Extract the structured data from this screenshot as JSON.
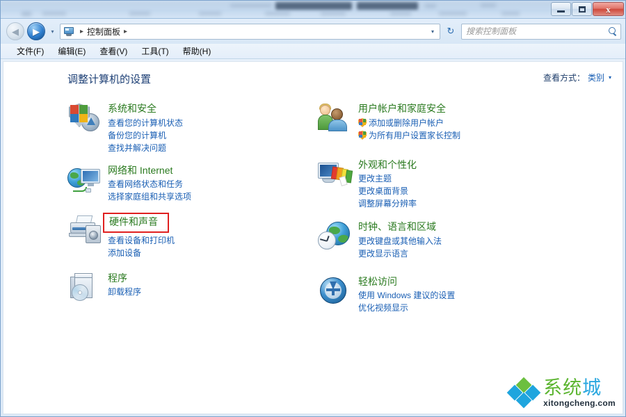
{
  "window": {
    "controls": {
      "minimize": "—",
      "maximize": "❐",
      "close": "x"
    }
  },
  "toolbar": {
    "back_tooltip": "后退",
    "forward_tooltip": "前进",
    "recent_pages_caret": "▾",
    "breadcrumb": {
      "icon": "control-panel-icon",
      "items": [
        "控制面板"
      ],
      "separator": "▸"
    },
    "address_caret": "▾",
    "refresh_icon": "↻",
    "search": {
      "placeholder": "搜索控制面板",
      "value": "",
      "icon": "search-icon"
    }
  },
  "menubar": {
    "items": [
      {
        "label": "文件(F)"
      },
      {
        "label": "编辑(E)"
      },
      {
        "label": "查看(V)"
      },
      {
        "label": "工具(T)"
      },
      {
        "label": "帮助(H)"
      }
    ]
  },
  "page": {
    "title": "调整计算机的设置",
    "view_by": {
      "label": "查看方式：",
      "value": "类别",
      "caret": "▾"
    }
  },
  "highlight": {
    "color": "#e02020",
    "target": "硬件和声音"
  },
  "categories": {
    "left": [
      {
        "icon": "security-shield-icon",
        "title": "系统和安全",
        "links": [
          {
            "label": "查看您的计算机状态",
            "shield": false
          },
          {
            "label": "备份您的计算机",
            "shield": false
          },
          {
            "label": "查找并解决问题",
            "shield": false
          }
        ]
      },
      {
        "icon": "network-globe-icon",
        "title": "网络和 Internet",
        "links": [
          {
            "label": "查看网络状态和任务",
            "shield": false
          },
          {
            "label": "选择家庭组和共享选项",
            "shield": false
          }
        ]
      },
      {
        "icon": "printer-hardware-icon",
        "title": "硬件和声音",
        "highlighted": true,
        "links": [
          {
            "label": "查看设备和打印机",
            "shield": false
          },
          {
            "label": "添加设备",
            "shield": false
          }
        ]
      },
      {
        "icon": "programs-box-icon",
        "title": "程序",
        "links": [
          {
            "label": "卸载程序",
            "shield": false
          }
        ]
      }
    ],
    "right": [
      {
        "icon": "user-accounts-icon",
        "title": "用户帐户和家庭安全",
        "links": [
          {
            "label": "添加或删除用户帐户",
            "shield": true
          },
          {
            "label": "为所有用户设置家长控制",
            "shield": true
          }
        ]
      },
      {
        "icon": "appearance-personalization-icon",
        "title": "外观和个性化",
        "links": [
          {
            "label": "更改主题",
            "shield": false
          },
          {
            "label": "更改桌面背景",
            "shield": false
          },
          {
            "label": "调整屏幕分辨率",
            "shield": false
          }
        ]
      },
      {
        "icon": "clock-language-region-icon",
        "title": "时钟、语言和区域",
        "links": [
          {
            "label": "更改键盘或其他输入法",
            "shield": false
          },
          {
            "label": "更改显示语言",
            "shield": false
          }
        ]
      },
      {
        "icon": "ease-of-access-icon",
        "title": "轻松访问",
        "links": [
          {
            "label": "使用 Windows 建议的设置",
            "shield": false
          },
          {
            "label": "优化视频显示",
            "shield": false
          }
        ]
      }
    ]
  },
  "watermark": {
    "name_part1": "系统",
    "name_part2": "城",
    "url": "xitongcheng.com",
    "logo": "diamond-logo"
  },
  "colors": {
    "category_title": "#2a7a1f",
    "link": "#1a5fb4",
    "page_title": "#1c3f75",
    "highlight_box": "#e02020"
  }
}
